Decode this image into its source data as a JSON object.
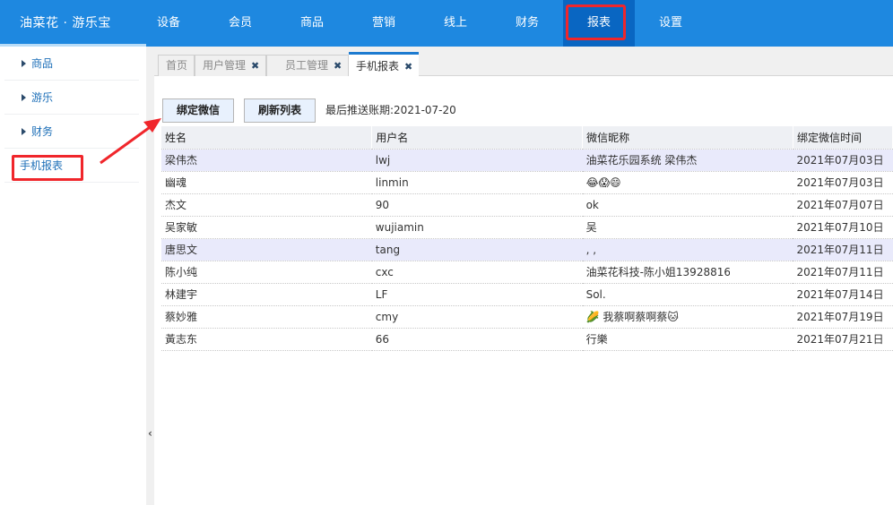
{
  "app": {
    "brand": "油菜花 · 游乐宝"
  },
  "nav": {
    "items": [
      {
        "label": "设备"
      },
      {
        "label": "会员"
      },
      {
        "label": "商品"
      },
      {
        "label": "营销"
      },
      {
        "label": "线上"
      },
      {
        "label": "财务"
      },
      {
        "label": "报表",
        "active": true
      },
      {
        "label": "设置"
      }
    ]
  },
  "sidebar": {
    "items": [
      {
        "label": "商品"
      },
      {
        "label": "游乐"
      },
      {
        "label": "财务"
      },
      {
        "label": "手机报表"
      }
    ]
  },
  "tabs": [
    {
      "label": "首页",
      "closable": false
    },
    {
      "label": "用户管理",
      "closable": true
    },
    {
      "label": "员工管理",
      "closable": true
    },
    {
      "label": "手机报表",
      "closable": true,
      "active": true
    }
  ],
  "tab_close_glyph": "✖",
  "collapse_glyph": "‹",
  "toolbar": {
    "bind_wechat": "绑定微信",
    "refresh_list": "刷新列表",
    "last_push_label": "最后推送账期:",
    "last_push_value": "2021-07-20"
  },
  "table": {
    "columns": [
      "姓名",
      "用户名",
      "微信昵称",
      "绑定微信时间"
    ],
    "rows": [
      {
        "name": "梁伟杰",
        "username": "lwj",
        "nickname": "油菜花乐园系统 梁伟杰",
        "bind_time": "2021年07月03日",
        "highlight": true
      },
      {
        "name": "幽魂",
        "username": "linmin",
        "nickname": "😂😱😄",
        "bind_time": "2021年07月03日"
      },
      {
        "name": "杰文",
        "username": "90",
        "nickname": "ok",
        "bind_time": "2021年07月07日"
      },
      {
        "name": "吴家敏",
        "username": "wujiamin",
        "nickname": "吴",
        "bind_time": "2021年07月10日"
      },
      {
        "name": "唐思文",
        "username": "tang",
        "nickname": ", ,",
        "bind_time": "2021年07月11日",
        "highlight": true
      },
      {
        "name": "陈小纯",
        "username": "cxc",
        "nickname": "油菜花科技-陈小姐13928816",
        "bind_time": "2021年07月11日"
      },
      {
        "name": "林建宇",
        "username": "LF",
        "nickname": "Sol.",
        "bind_time": "2021年07月14日"
      },
      {
        "name": "蔡妙雅",
        "username": "cmy",
        "nickname": "🌽 我蔡啊蔡啊蔡🐱",
        "bind_time": "2021年07月19日"
      },
      {
        "name": "黃志东",
        "username": "66",
        "nickname": "行樂",
        "bind_time": "2021年07月21日"
      }
    ]
  },
  "annotation_color": "#f0262b",
  "accent_color": "#1e88e0"
}
